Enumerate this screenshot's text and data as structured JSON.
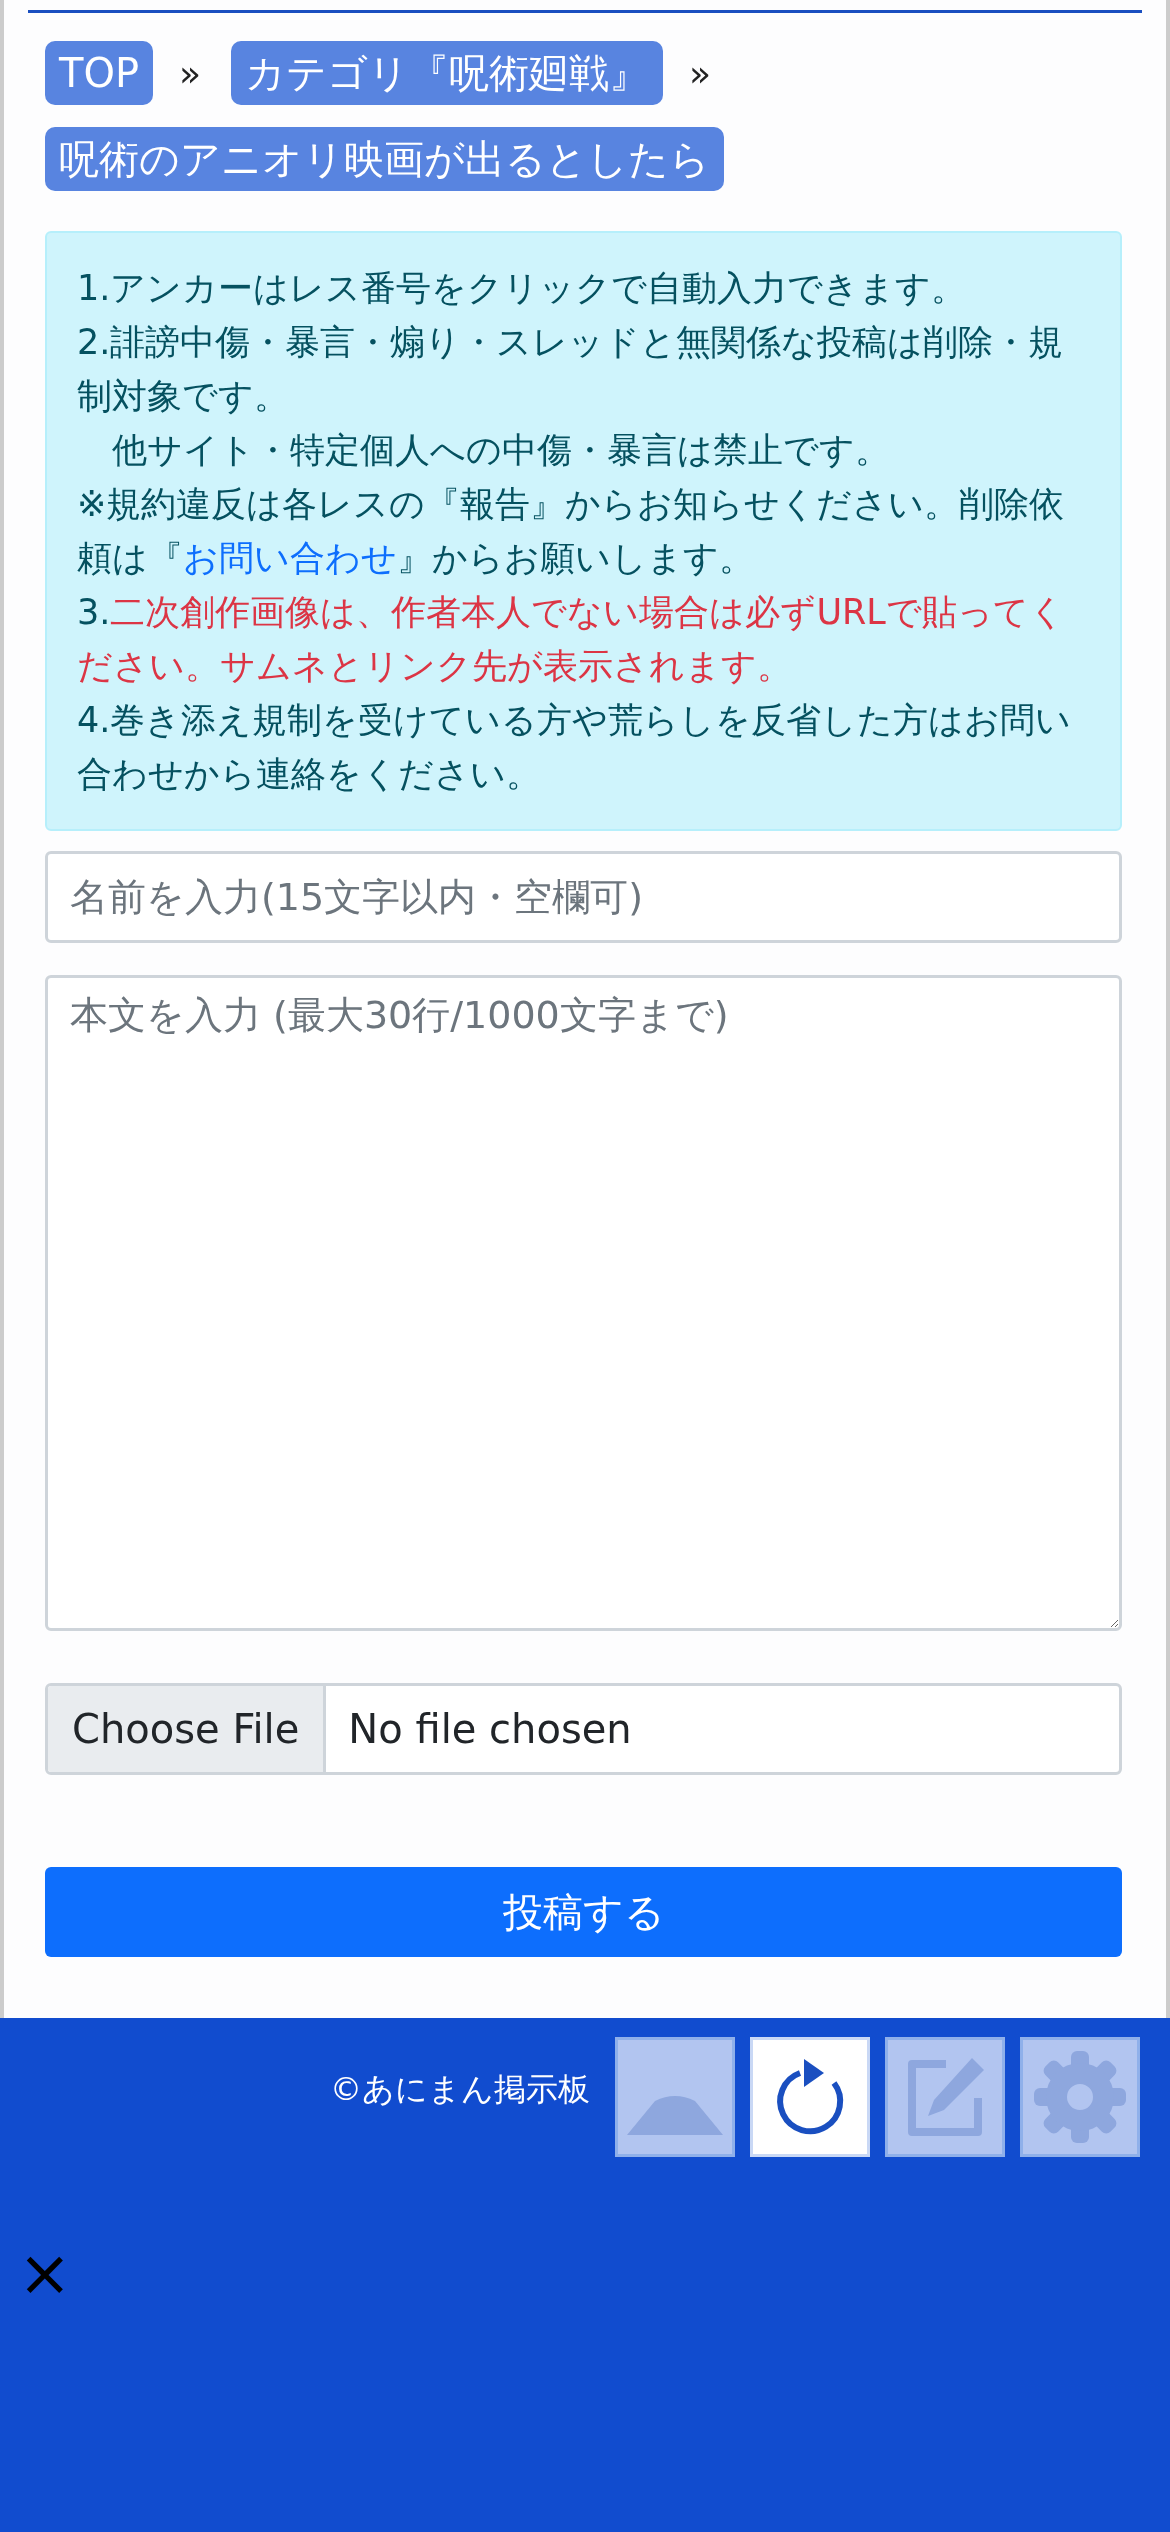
{
  "breadcrumbs": [
    {
      "label": "TOP",
      "separator": "»"
    },
    {
      "label": "カテゴリ『呪術廻戦』",
      "separator": "»"
    },
    {
      "label": "呪術のアニオリ映画が出るとしたら"
    }
  ],
  "notice": [
    {
      "segments": [
        {
          "kind": "text",
          "text": "1.アンカーはレス番号をクリックで自動入力できます。"
        }
      ]
    },
    {
      "segments": [
        {
          "kind": "text",
          "text": "2.誹謗中傷・暴言・煽り・スレッドと無関係な投稿は削除・規制対象です。"
        }
      ]
    },
    {
      "segments": [
        {
          "kind": "text",
          "text": "　他サイト・特定個人への中傷・暴言は禁止です。"
        }
      ]
    },
    {
      "segments": [
        {
          "kind": "text",
          "text": "※規約違反は各レスの『報告』からお知らせください。削除依頼は『"
        },
        {
          "kind": "link",
          "text": "お問い合わせ"
        },
        {
          "kind": "text",
          "text": "』からお願いします。"
        }
      ]
    },
    {
      "segments": [
        {
          "kind": "text",
          "text": "3."
        },
        {
          "kind": "alert",
          "text": "二次創作画像は、作者本人でない場合は必ずURLで貼ってください。サムネとリンク先が表示されます。"
        }
      ]
    },
    {
      "segments": [
        {
          "kind": "text",
          "text": "4.巻き添え規制を受けている方や荒らしを反省した方はお問い合わせから連絡をください。"
        }
      ]
    }
  ],
  "name_field": {
    "placeholder": "名前を入力(15文字以内・空欄可)"
  },
  "body_field": {
    "placeholder": "本文を入力 (最大30行/1000文字まで)"
  },
  "file_input": {
    "button": "Choose File",
    "status": "No file chosen"
  },
  "submit": "投稿する",
  "footer": {
    "copyright": "©あにまん掲示板",
    "close": "×"
  },
  "floating_buttons": [
    {
      "kind": "up",
      "disabled": true
    },
    {
      "kind": "reload",
      "disabled": false
    },
    {
      "kind": "edit",
      "disabled": true
    },
    {
      "kind": "settings",
      "disabled": true
    }
  ]
}
